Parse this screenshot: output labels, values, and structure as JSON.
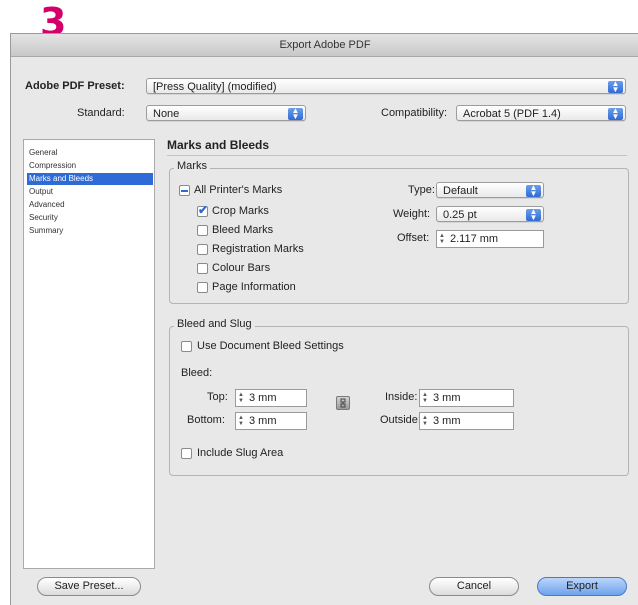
{
  "step_number": "3",
  "window": {
    "title": "Export Adobe PDF"
  },
  "preset": {
    "label": "Adobe PDF Preset:",
    "value": "[Press Quality] (modified)"
  },
  "standard": {
    "label": "Standard:",
    "value": "None"
  },
  "compatibility": {
    "label": "Compatibility:",
    "value": "Acrobat 5 (PDF 1.4)"
  },
  "sidebar": {
    "items": [
      {
        "label": "General"
      },
      {
        "label": "Compression"
      },
      {
        "label": "Marks and Bleeds",
        "selected": true
      },
      {
        "label": "Output"
      },
      {
        "label": "Advanced"
      },
      {
        "label": "Security"
      },
      {
        "label": "Summary"
      }
    ]
  },
  "panel": {
    "title": "Marks and Bleeds"
  },
  "marks": {
    "group_label": "Marks",
    "all_printers_marks": "All Printer's Marks",
    "crop_marks": "Crop Marks",
    "bleed_marks": "Bleed Marks",
    "registration_marks": "Registration Marks",
    "colour_bars": "Colour Bars",
    "page_information": "Page Information",
    "type_label": "Type:",
    "type_value": "Default",
    "weight_label": "Weight:",
    "weight_value": "0.25 pt",
    "offset_label": "Offset:",
    "offset_value": "2.117 mm"
  },
  "bleed_slug": {
    "group_label": "Bleed and Slug",
    "use_document_bleed": "Use Document Bleed Settings",
    "bleed_label": "Bleed:",
    "top_label": "Top:",
    "top_value": "3 mm",
    "bottom_label": "Bottom:",
    "bottom_value": "3 mm",
    "inside_label": "Inside:",
    "inside_value": "3 mm",
    "outside_label": "Outside:",
    "outside_value": "3 mm",
    "include_slug": "Include Slug Area"
  },
  "buttons": {
    "save_preset": "Save Preset...",
    "cancel": "Cancel",
    "export": "Export"
  },
  "colors": {
    "step_number": "#d4006a",
    "selection": "#2f6bd6"
  }
}
